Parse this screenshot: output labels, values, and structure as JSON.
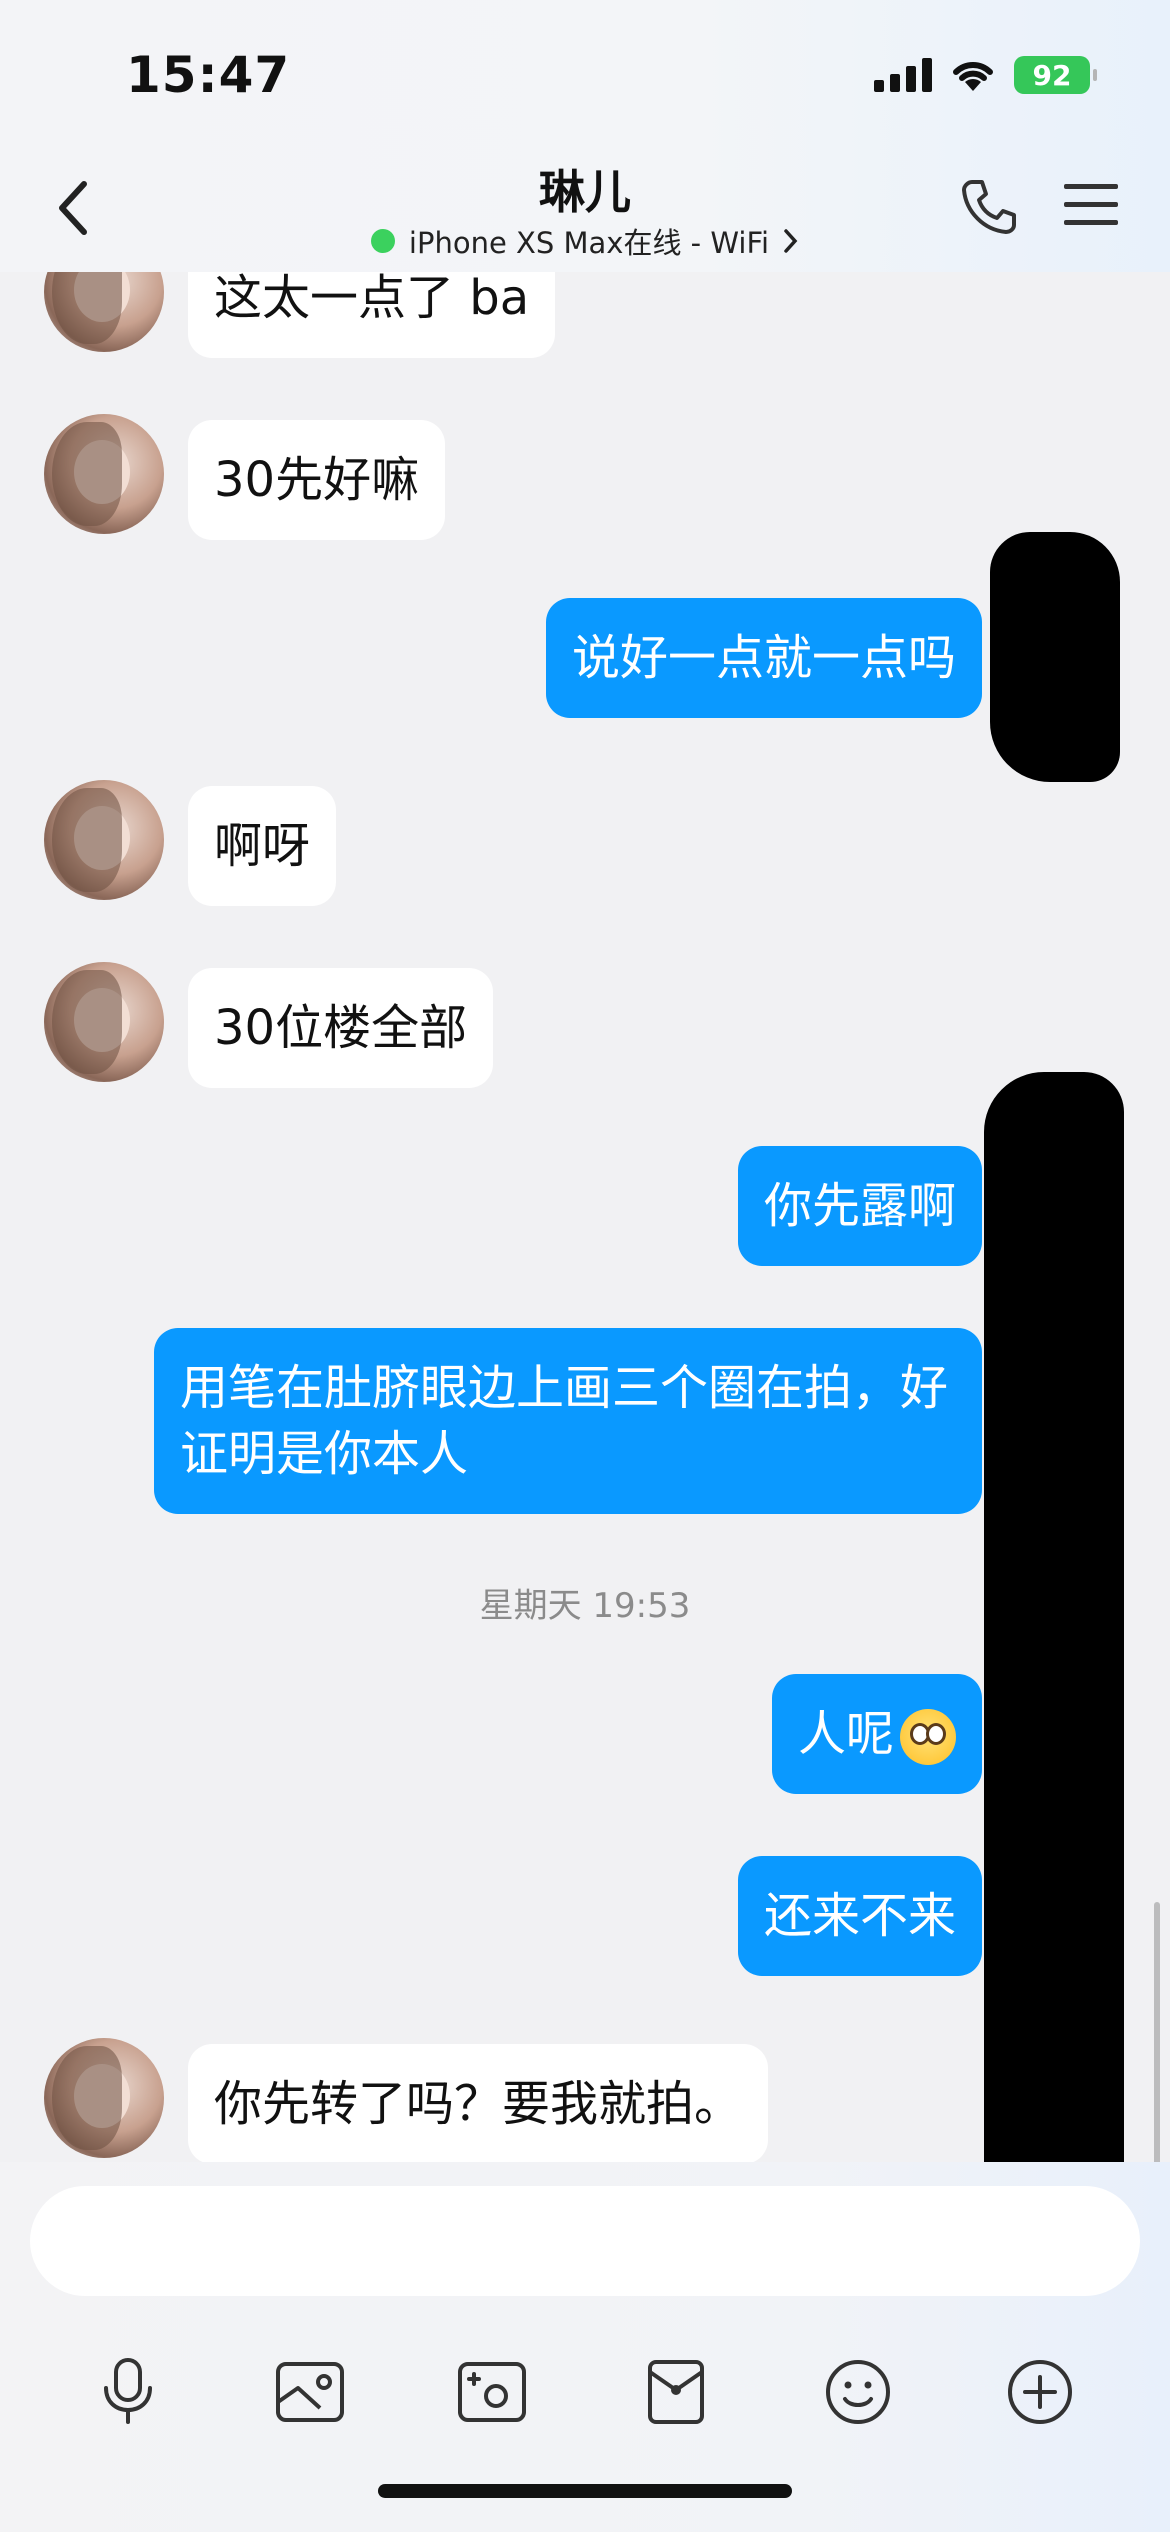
{
  "status_bar": {
    "time": "15:47",
    "battery": "92"
  },
  "nav": {
    "title": "琳儿",
    "subtitle": "iPhone XS Max在线 - WiFi",
    "back_icon": "chevron-left-icon",
    "call_icon": "phone-icon",
    "menu_icon": "menu-icon"
  },
  "messages": [
    {
      "side": "in",
      "text": "这太一点了 ba"
    },
    {
      "side": "in",
      "text": "30先好嘛"
    },
    {
      "side": "out",
      "text": "说好一点就一点吗"
    },
    {
      "side": "in",
      "text": "啊呀"
    },
    {
      "side": "in",
      "text": "30位楼全部"
    },
    {
      "side": "out",
      "text": "你先露啊"
    },
    {
      "side": "out",
      "text": "用笔在肚脐眼边上画三个圈在拍，好证明是你本人"
    },
    {
      "side": "time",
      "text": "星期天 19:53"
    },
    {
      "side": "out",
      "text": "人呢"
    },
    {
      "side": "out",
      "text": "还来不来"
    },
    {
      "side": "in",
      "text": "你先转了吗？要我就拍。"
    }
  ],
  "input": {
    "placeholder": ""
  },
  "toolbar": [
    "microphone-icon",
    "image-icon",
    "camera-icon",
    "red-packet-icon",
    "emoji-icon",
    "plus-icon"
  ],
  "colors": {
    "outgoing_bubble": "#0a99ff",
    "incoming_bubble": "#ffffff",
    "online": "#3bd15e",
    "battery": "#35c759"
  }
}
